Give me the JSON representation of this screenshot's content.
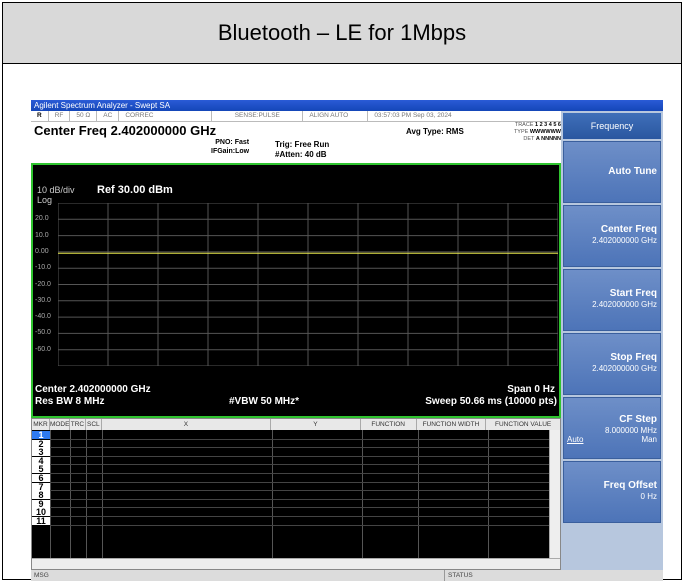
{
  "page_title": "Bluetooth – LE for 1Mbps",
  "window_title": "Agilent Spectrum Analyzer - Swept SA",
  "status_cells": [
    "RF",
    "50 Ω",
    "AC",
    "CORREC",
    "SENSE:PULSE",
    "ALIGN AUTO",
    "03:57:03 PM Sep 03, 2024"
  ],
  "mode_indicator": "R",
  "center_freq_header": "Center Freq 2.402000000 GHz",
  "pno": "PNO: Fast",
  "ifgain": "IFGain:Low",
  "trig": "Trig: Free Run",
  "atten": "#Atten: 40 dB",
  "avg_type": "Avg Type: RMS",
  "trace": {
    "trace_label": "TRACE",
    "trace_nums": "1 2 3 4 5 6",
    "type_label": "TYPE",
    "type_val": "WWWWWW",
    "det_label": "DET",
    "det_val": "A NNNNN"
  },
  "display": {
    "scale": "10 dB/div",
    "log": "Log",
    "ref": "Ref 30.00 dBm",
    "y_ticks": [
      "20.0",
      "10.0",
      "0.00",
      "-10.0",
      "-20.0",
      "-30.0",
      "-40.0",
      "-50.0",
      "-60.0"
    ],
    "center": "Center 2.402000000 GHz",
    "span": "Span 0 Hz",
    "rbw": "Res BW 8 MHz",
    "vbw": "#VBW 50 MHz*",
    "sweep": "Sweep  50.66 ms (10000 pts)"
  },
  "chart_data": {
    "type": "line",
    "ylim": [
      -70,
      30
    ],
    "ylabel": "",
    "series": [
      {
        "values_dbm": [
          -0.8,
          -0.8
        ]
      }
    ],
    "grid": true
  },
  "marker_table": {
    "headers": [
      "MKR",
      "MODE",
      "TRC",
      "SCL",
      "X",
      "Y",
      "FUNCTION",
      "FUNCTION WIDTH",
      "FUNCTION VALUE"
    ],
    "rows": [
      "1",
      "2",
      "3",
      "4",
      "5",
      "6",
      "7",
      "8",
      "9",
      "10",
      "11"
    ]
  },
  "msg_label": "MSG",
  "status_label": "STATUS",
  "softkeys": {
    "menu_title": "Frequency",
    "auto_tune": "Auto Tune",
    "center_freq": "Center Freq",
    "center_freq_val": "2.402000000 GHz",
    "start_freq": "Start Freq",
    "start_freq_val": "2.402000000 GHz",
    "stop_freq": "Stop Freq",
    "stop_freq_val": "2.402000000 GHz",
    "cf_step": "CF Step",
    "cf_step_val": "8.000000 MHz",
    "auto": "Auto",
    "man": "Man",
    "freq_offset": "Freq Offset",
    "freq_offset_val": "0 Hz"
  },
  "colors": {
    "accent_green": "#2fc42f",
    "trace_yellow": "#e8e84a",
    "softkey_blue": "#4d74b8"
  }
}
